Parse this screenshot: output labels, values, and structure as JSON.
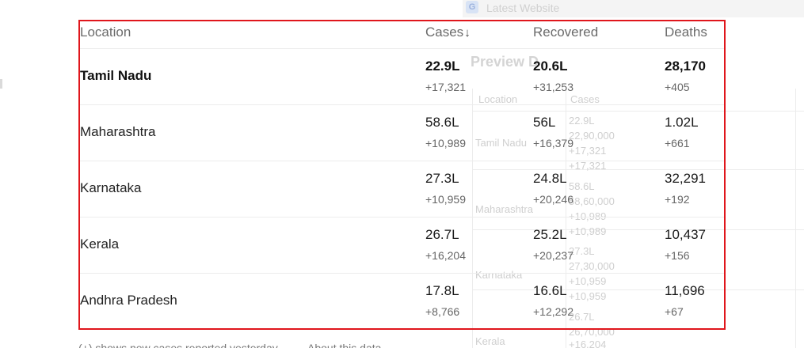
{
  "background": {
    "app_title": "Latest Website",
    "preview_heading": "Preview D",
    "columns": [
      "Location",
      "Cases"
    ],
    "cells": [
      {
        "text": "22.9L"
      },
      {
        "text": "22,90,000"
      },
      {
        "text": "Tamil Nadu"
      },
      {
        "text": "+17,321"
      },
      {
        "text": "+17,321"
      },
      {
        "text": "58.6L"
      },
      {
        "text": "58,60,000"
      },
      {
        "text": "Maharashtra"
      },
      {
        "text": "+10,989"
      },
      {
        "text": "+10,989"
      },
      {
        "text": "27.3L"
      },
      {
        "text": "27,30,000"
      },
      {
        "text": "Karnataka"
      },
      {
        "text": "+10,959"
      },
      {
        "text": "+10,959"
      },
      {
        "text": "26.7L"
      },
      {
        "text": "26,70,000"
      },
      {
        "text": "Kerala"
      },
      {
        "text": "+16,204"
      }
    ]
  },
  "table": {
    "headers": {
      "location": "Location",
      "cases": "Cases",
      "cases_sort_icon": "↓",
      "recovered": "Recovered",
      "deaths": "Deaths"
    },
    "rows": [
      {
        "location": "Tamil Nadu",
        "cases": "22.9L",
        "cases_new": "+17,321",
        "recovered": "20.6L",
        "recovered_new": "+31,253",
        "deaths": "28,170",
        "deaths_new": "+405"
      },
      {
        "location": "Maharashtra",
        "cases": "58.6L",
        "cases_new": "+10,989",
        "recovered": "56L",
        "recovered_new": "+16,379",
        "deaths": "1.02L",
        "deaths_new": "+661"
      },
      {
        "location": "Karnataka",
        "cases": "27.3L",
        "cases_new": "+10,959",
        "recovered": "24.8L",
        "recovered_new": "+20,246",
        "deaths": "32,291",
        "deaths_new": "+192"
      },
      {
        "location": "Kerala",
        "cases": "26.7L",
        "cases_new": "+16,204",
        "recovered": "25.2L",
        "recovered_new": "+20,237",
        "deaths": "10,437",
        "deaths_new": "+156"
      },
      {
        "location": "Andhra Pradesh",
        "cases": "17.8L",
        "cases_new": "+8,766",
        "recovered": "16.6L",
        "recovered_new": "+12,292",
        "deaths": "11,696",
        "deaths_new": "+67"
      }
    ]
  },
  "footer": {
    "note": "(+) shows new cases reported yesterday",
    "about_link": "About this data"
  },
  "colors": {
    "highlight_border": "#e0161c",
    "row_divider": "#ececec",
    "header_text": "#6b6b6b",
    "secondary_text": "#666666"
  }
}
